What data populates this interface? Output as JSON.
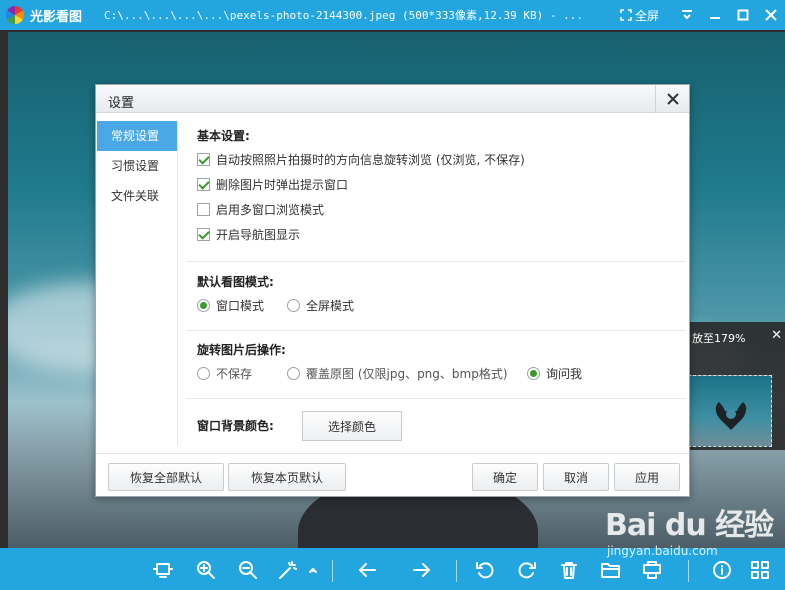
{
  "titlebar": {
    "app_name": "光影看图",
    "file_title": "C:\\...\\...\\...\\...\\pexels-photo-2144300.jpeg (500*333像素,12.39 KB) - ...",
    "fullscreen_label": "全屏"
  },
  "navigator": {
    "zoom_text": "放至179%",
    "close_glyph": "✕"
  },
  "dialog": {
    "title": "设置",
    "sidebar": [
      {
        "label": "常规设置",
        "active": true
      },
      {
        "label": "习惯设置",
        "active": false
      },
      {
        "label": "文件关联",
        "active": false
      }
    ],
    "basic": {
      "title": "基本设置:",
      "options": [
        {
          "label": "自动按照照片拍摄时的方向信息旋转浏览 (仅浏览, 不保存)",
          "checked": true
        },
        {
          "label": "删除图片时弹出提示窗口",
          "checked": true
        },
        {
          "label": "启用多窗口浏览模式",
          "checked": false
        },
        {
          "label": "开启导航图显示",
          "checked": true
        }
      ]
    },
    "view_mode": {
      "title": "默认看图模式:",
      "options": [
        {
          "label": "窗口模式",
          "selected": true
        },
        {
          "label": "全屏模式",
          "selected": false
        }
      ]
    },
    "after_rotate": {
      "title": "旋转图片后操作:",
      "options": [
        {
          "label": "不保存",
          "selected": false
        },
        {
          "label": "覆盖原图 (仅限jpg、png、bmp格式)",
          "selected": false
        },
        {
          "label": "询问我",
          "selected": true
        }
      ]
    },
    "bg_color": {
      "title": "窗口背景颜色:",
      "button_label": "选择颜色"
    },
    "footer": {
      "restore_all": "恢复全部默认",
      "restore_page": "恢复本页默认",
      "ok": "确定",
      "cancel": "取消",
      "apply": "应用"
    }
  },
  "watermark": {
    "brand": "Bai du 经验",
    "url": "jingyan.baidu.com"
  },
  "colors": {
    "accent": "#23a6e0",
    "sidebar_active": "#4aa8e6",
    "check_green": "#3a9a2a"
  },
  "bottombar_icons": [
    "fit-screen-icon",
    "zoom-in-icon",
    "zoom-out-icon",
    "magic-wand-icon",
    "previous-icon",
    "next-icon",
    "rotate-left-icon",
    "rotate-right-icon",
    "delete-icon",
    "open-folder-icon",
    "print-icon",
    "info-icon",
    "grid-icon"
  ]
}
